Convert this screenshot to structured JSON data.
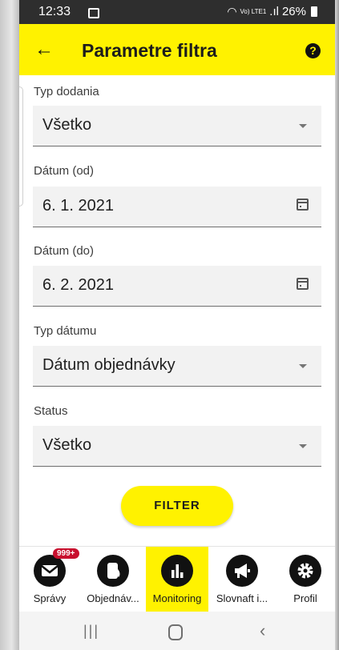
{
  "status": {
    "time": "12:33",
    "network": "Vo) LTE1",
    "battery": "26%"
  },
  "appbar": {
    "title": "Parametre filtra",
    "back_icon": "arrow-left-icon",
    "help_icon": "help-circle-icon",
    "help_glyph": "?"
  },
  "fields": {
    "delivery_type": {
      "label": "Typ dodania",
      "value": "Všetko"
    },
    "date_from": {
      "label": "Dátum (od)",
      "value": "6. 1. 2021"
    },
    "date_to": {
      "label": "Dátum (do)",
      "value": "6. 2. 2021"
    },
    "date_type": {
      "label": "Typ dátumu",
      "value": "Dátum objednávky"
    },
    "status": {
      "label": "Status",
      "value": "Všetko"
    }
  },
  "filter_button": {
    "label": "FILTER"
  },
  "bottom_nav": {
    "items": [
      {
        "label": "Správy",
        "icon": "envelope-icon",
        "badge": "999+"
      },
      {
        "label": "Objednáv...",
        "icon": "fuel-drop-icon"
      },
      {
        "label": "Monitoring",
        "icon": "bar-chart-icon",
        "active": true
      },
      {
        "label": "Slovnaft i...",
        "icon": "megaphone-icon"
      },
      {
        "label": "Profil",
        "icon": "gear-icon"
      }
    ]
  },
  "colors": {
    "accent": "#fff200",
    "badge": "#c8102e",
    "status_bar": "#2e2e2e"
  }
}
